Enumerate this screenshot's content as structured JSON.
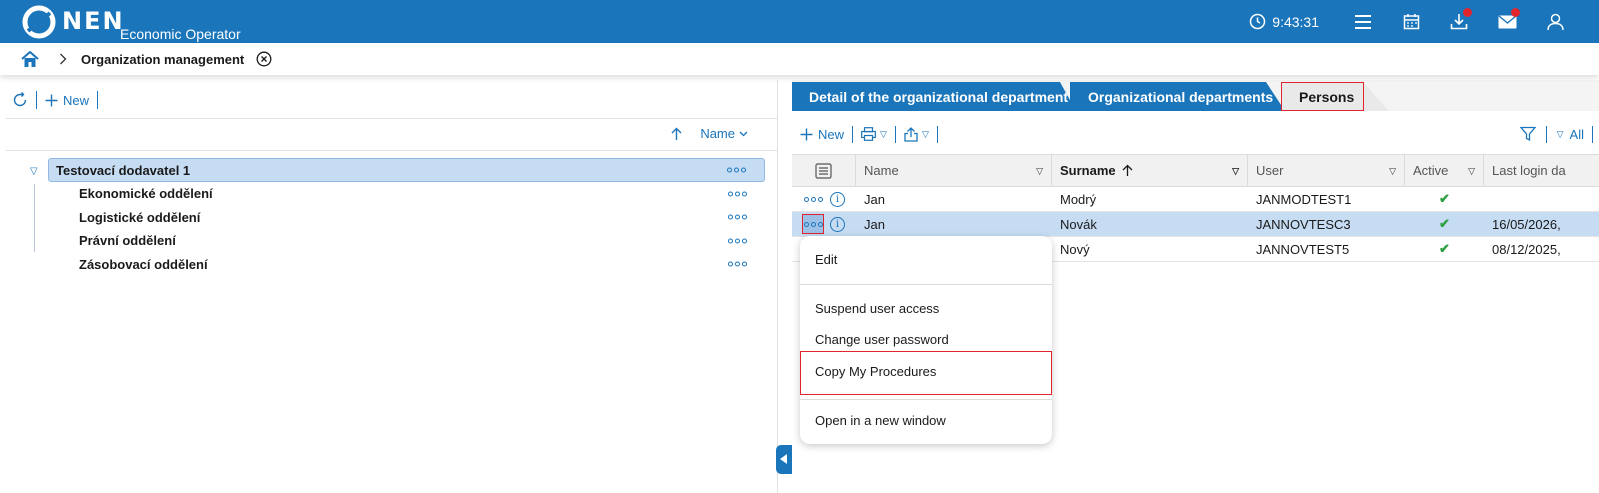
{
  "topbar": {
    "brand": "NEN",
    "subtitle": "Economic Operator",
    "clock": "9:43:31",
    "icons": [
      "clock-icon",
      "hamburger-menu-icon",
      "calendar-icon",
      "download-icon",
      "mail-icon",
      "user-icon"
    ],
    "accent": "#1b75bb",
    "badge_color": "#e0252f"
  },
  "breadcrumb": {
    "title": "Organization management"
  },
  "left": {
    "toolbar": {
      "new_label": "New"
    },
    "sort": {
      "label": "Name"
    },
    "tree": {
      "root": "Testovací dodavatel 1",
      "children": [
        "Ekonomické oddělení",
        "Logistické oddělení",
        "Právní oddělení",
        "Zásobovací oddělení"
      ]
    }
  },
  "right": {
    "tabs": [
      "Detail of the organizational department",
      "Organizational departments",
      "Persons"
    ],
    "active_tab": "Persons",
    "toolbar": {
      "new_label": "New",
      "filter_all": "All"
    },
    "columns": [
      "Name",
      "Surname",
      "User",
      "Active",
      "Last login da"
    ],
    "rows": [
      {
        "name": "Jan",
        "surname": "Modrý",
        "user": "JANMODTEST1",
        "active": "✔",
        "last_login": ""
      },
      {
        "name": "Jan",
        "surname": "Novák",
        "user": "JANNOVTESC3",
        "active": "✔",
        "last_login": "16/05/2026,"
      },
      {
        "name": "",
        "surname": "Nový",
        "user": "JANNOVTEST5",
        "active": "✔",
        "last_login": "08/12/2025,"
      }
    ]
  },
  "context_menu": {
    "items": [
      "Edit",
      "Suspend user access",
      "Change user password",
      "Copy My Procedures",
      "Open in a new window"
    ],
    "highlighted": "Copy My Procedures"
  }
}
